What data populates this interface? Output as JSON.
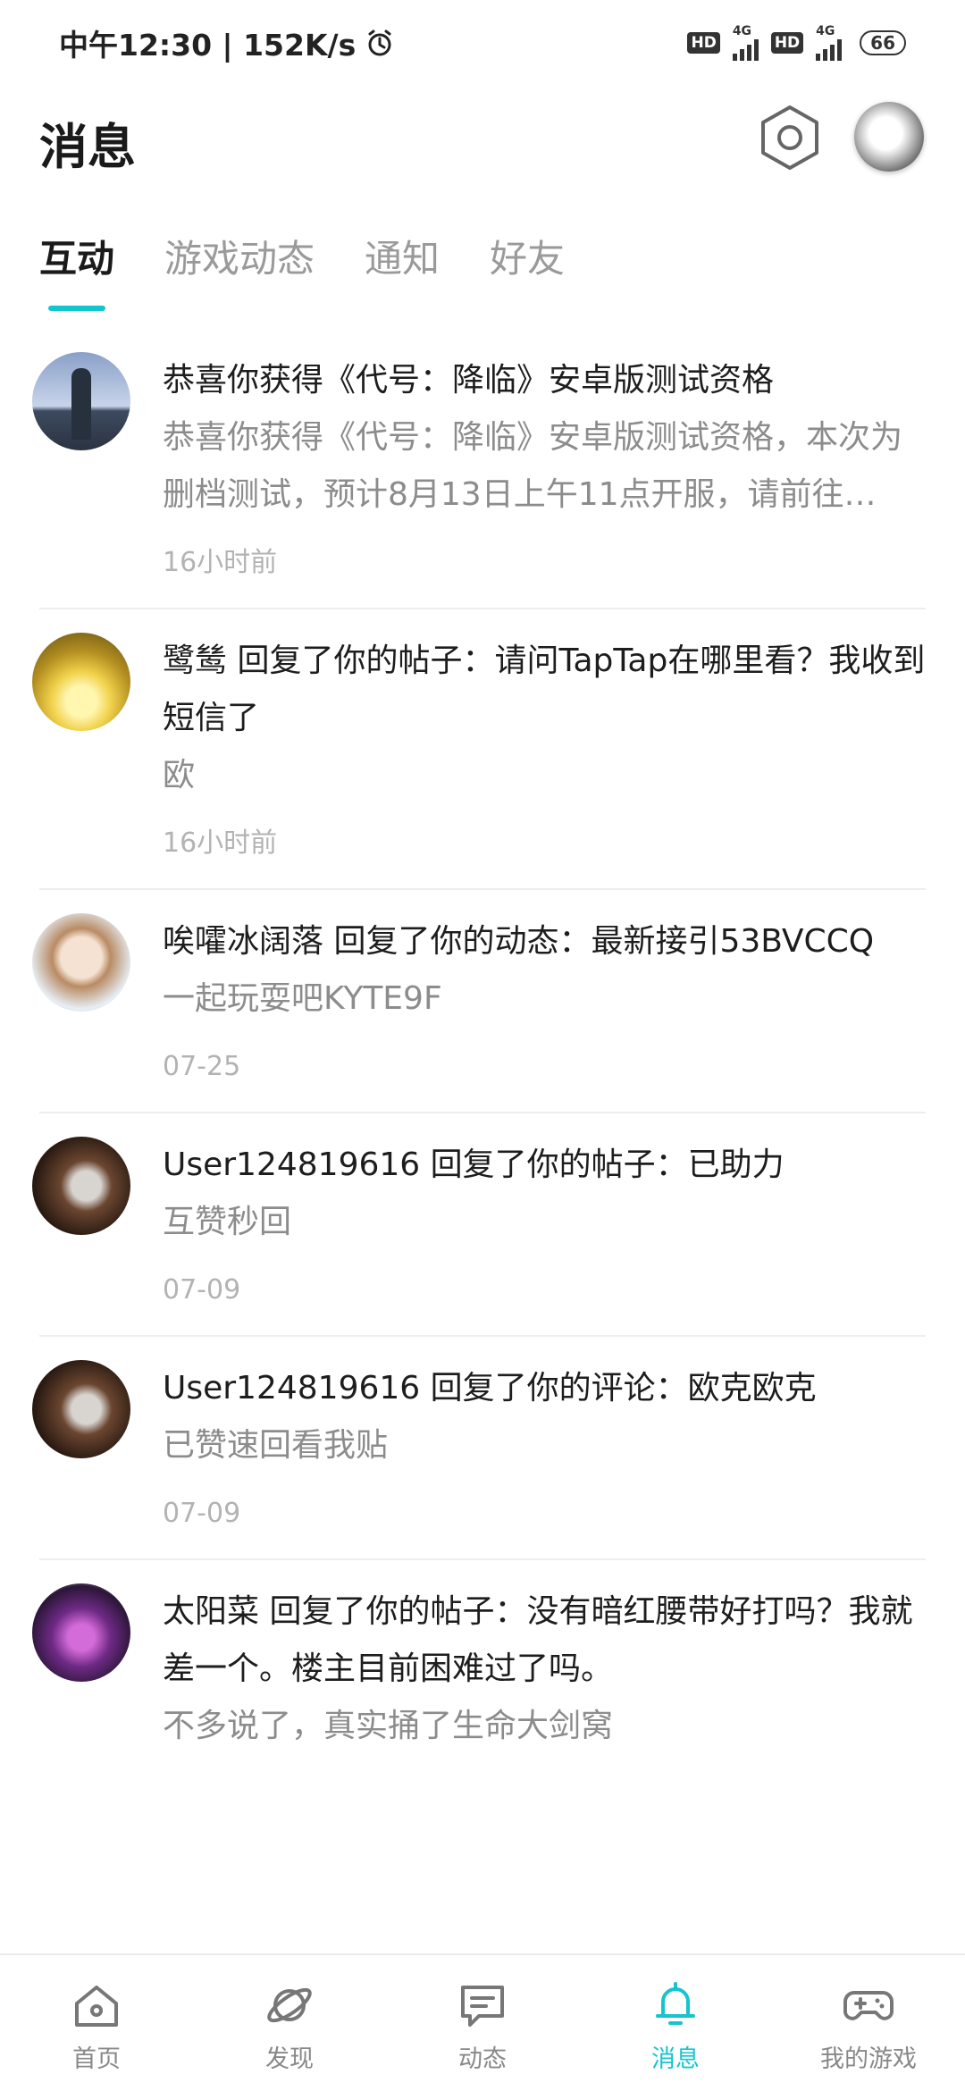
{
  "status_bar": {
    "time": "中午12:30 | 152K/s",
    "network": "4G",
    "hd_label": "HD",
    "battery": "66"
  },
  "header": {
    "title": "消息"
  },
  "tabs": [
    {
      "label": "互动",
      "active": true
    },
    {
      "label": "游戏动态",
      "active": false
    },
    {
      "label": "通知",
      "active": false
    },
    {
      "label": "好友",
      "active": false
    }
  ],
  "messages": [
    {
      "title": "恭喜你获得《代号：降临》安卓版测试资格",
      "body": "恭喜你获得《代号：降临》安卓版测试资格，本次为删档测试，预计8月13日上午11点开服，请前往TapTap查看详情",
      "time": "16小时前"
    },
    {
      "title": "鹭鸶 回复了你的帖子：请问TapTap在哪里看？我收到短信了",
      "body": "欧",
      "time": "16小时前"
    },
    {
      "title": "唉嚯冰阔落 回复了你的动态：最新接引53BVCCQ",
      "body": "一起玩耍吧KYTE9F",
      "time": "07-25"
    },
    {
      "title": "User124819616 回复了你的帖子：已助力",
      "body": "互赞秒回",
      "time": "07-09"
    },
    {
      "title": "User124819616 回复了你的评论：欧克欧克",
      "body": "已赞速回看我贴",
      "time": "07-09"
    },
    {
      "title": "太阳菜 回复了你的帖子：没有暗红腰带好打吗？我就差一个。楼主目前困难过了吗。",
      "body": "不多说了，真实捅了生命大剑窝",
      "time": ""
    }
  ],
  "bottom_nav": [
    {
      "label": "首页",
      "icon": "home-icon",
      "active": false
    },
    {
      "label": "发现",
      "icon": "planet-icon",
      "active": false
    },
    {
      "label": "动态",
      "icon": "chat-icon",
      "active": false
    },
    {
      "label": "消息",
      "icon": "bell-icon",
      "active": true
    },
    {
      "label": "我的游戏",
      "icon": "gamepad-icon",
      "active": false
    }
  ],
  "colors": {
    "accent": "#15c5ce",
    "muted_text": "#8c8c8c",
    "time_text": "#b3b3b3"
  }
}
